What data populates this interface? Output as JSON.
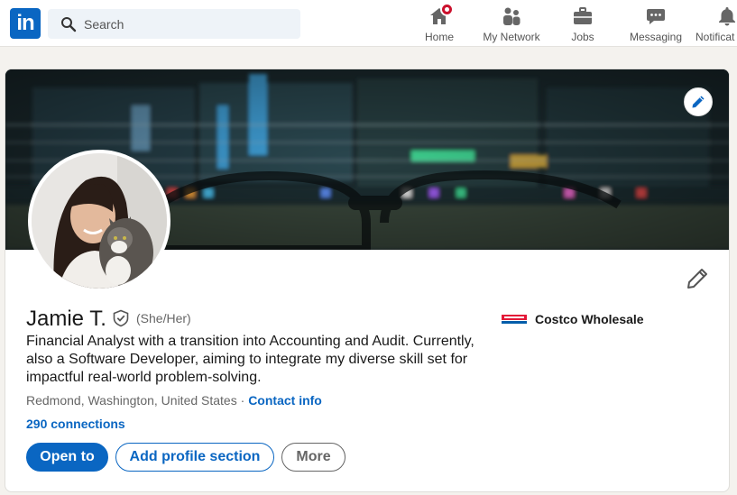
{
  "nav": {
    "search_placeholder": "Search",
    "items": [
      {
        "label": "Home",
        "icon": "home-icon",
        "badge": true
      },
      {
        "label": "My Network",
        "icon": "network-icon"
      },
      {
        "label": "Jobs",
        "icon": "briefcase-icon"
      },
      {
        "label": "Messaging",
        "icon": "messaging-icon"
      },
      {
        "label": "Notificat",
        "icon": "bell-icon"
      }
    ],
    "logo_text": "in"
  },
  "profile": {
    "name": "Jamie T.",
    "pronouns": "(She/Her)",
    "headline": "Financial Analyst with a transition into Accounting and Audit. Currently, also a Software Developer, aiming to integrate my diverse skill set for impactful real-world problem-solving.",
    "location": "Redmond, Washington, United States",
    "separator": " · ",
    "contact_info": "Contact info",
    "connections": "290 connections",
    "company": "Costco Wholesale",
    "buttons": {
      "open_to": "Open to",
      "add_section": "Add profile section",
      "more": "More"
    }
  },
  "colors": {
    "brand": "#0a66c2",
    "badge": "#cb112d",
    "costco_red": "#e31837",
    "costco_blue": "#005daa"
  }
}
